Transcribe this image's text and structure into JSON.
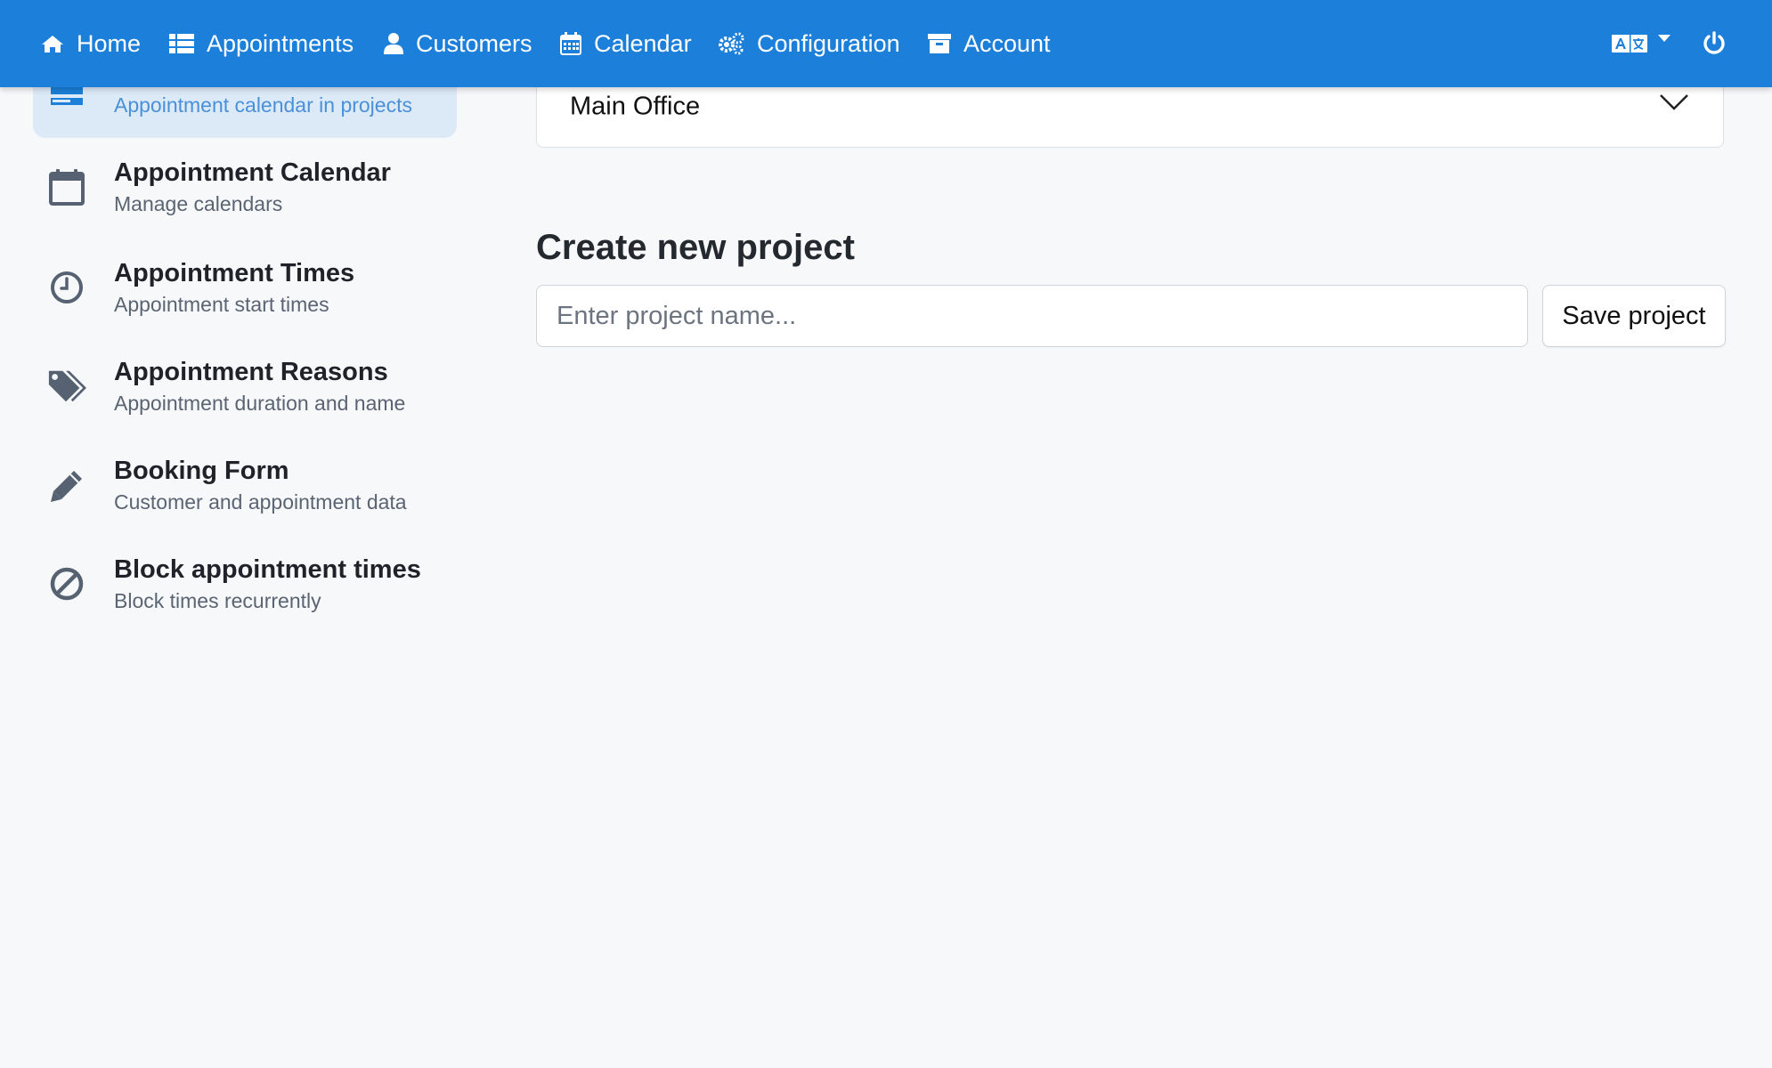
{
  "nav": {
    "items": [
      {
        "label": "Home",
        "icon": "home-icon"
      },
      {
        "label": "Appointments",
        "icon": "list-icon"
      },
      {
        "label": "Customers",
        "icon": "user-icon"
      },
      {
        "label": "Calendar",
        "icon": "calendar-icon"
      },
      {
        "label": "Configuration",
        "icon": "gears-icon"
      },
      {
        "label": "Account",
        "icon": "archive-icon"
      }
    ],
    "language_icon": "language-icon",
    "power_icon": "power-icon",
    "accent_color": "#1c7fda"
  },
  "sidebar": {
    "items": [
      {
        "title": "",
        "subtitle": "Appointment calendar in projects",
        "icon": "projects-icon",
        "active": true
      },
      {
        "title": "Appointment Calendar",
        "subtitle": "Manage calendars",
        "icon": "calendar-icon"
      },
      {
        "title": "Appointment Times",
        "subtitle": "Appointment start times",
        "icon": "clock-icon"
      },
      {
        "title": "Appointment Reasons",
        "subtitle": "Appointment duration and name",
        "icon": "tags-icon"
      },
      {
        "title": "Booking Form",
        "subtitle": "Customer and appointment data",
        "icon": "pencil-icon"
      },
      {
        "title": "Block appointment times",
        "subtitle": "Block times recurrently",
        "icon": "ban-icon"
      }
    ]
  },
  "main": {
    "project_select": {
      "value": "Main Office"
    },
    "create_title": "Create new project",
    "project_name": {
      "placeholder": "Enter project name...",
      "value": ""
    },
    "save_label": "Save project"
  }
}
